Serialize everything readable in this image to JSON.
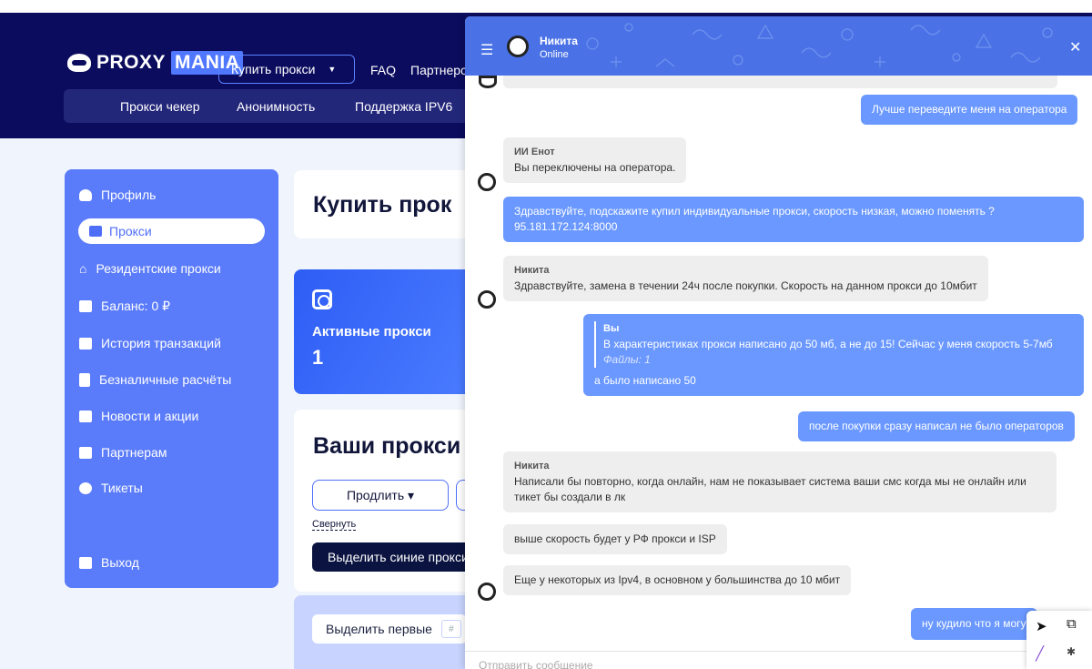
{
  "site": {
    "logo_main": "PROXY",
    "logo_accent": "MANIA",
    "buy_button": "Купить прокси",
    "nav": [
      "FAQ",
      "Партнерс"
    ],
    "subnav": [
      "Прокси чекер",
      "Анонимность",
      "Поддержка IPV6"
    ]
  },
  "sidebar": {
    "items": [
      {
        "label": "Профиль",
        "icon": "user-icon"
      },
      {
        "label": "Прокси",
        "icon": "proxy-icon",
        "active": true
      },
      {
        "label": "Резидентские прокси",
        "icon": "home-icon"
      },
      {
        "label": "Баланс: 0 ₽",
        "icon": "wallet-icon"
      },
      {
        "label": "История транзакций",
        "icon": "history-icon"
      },
      {
        "label": "Безналичные расчёты",
        "icon": "document-icon"
      },
      {
        "label": "Новости и акции",
        "icon": "news-icon"
      },
      {
        "label": "Партнерам",
        "icon": "handshake-icon"
      },
      {
        "label": "Тикеты",
        "icon": "chat-icon"
      },
      {
        "label": "Выход",
        "icon": "logout-icon"
      }
    ]
  },
  "main": {
    "buy_title": "Купить прок",
    "active_label": "Активные прокси",
    "active_count": "1",
    "your_proxies_title": "Ваши прокси",
    "prolong_button": "Продлить ▾",
    "collapse_link": "Свернуть",
    "highlight_blue_button": "Выделить синие прокси",
    "select_first_label": "Выделить первые",
    "select_first_placeholder": "#"
  },
  "chat": {
    "contact_name": "Никита",
    "contact_status": "Online",
    "messages": {
      "m1": "Лучше переведите меня на оператора",
      "m2_author": "ИИ Енот",
      "m2": "Вы переключены на оператора.",
      "m3_line1": "Здравствуйте, подскажите купил индивидуальные прокси, скорость низкая, можно поменять ?",
      "m3_line2": "95.181.172.124:8000",
      "m4_author": "Никита",
      "m4": "Здравствуйте, замена в течении 24ч после покупки. Скорость на данном прокси до 10мбит",
      "m5_quote_author": "Вы",
      "m5_quote_text": "В характеристиках прокси написано до 50 мб, а не до 15! Сейчас у меня скорость 5-7мб",
      "m5_quote_files": "Файлы: 1",
      "m5_text": "а было написано 50",
      "m6": "после покупки сразу написал не было операторов",
      "m7_author": "Никита",
      "m7_line1": "Написали бы повторно, когда онлайн, нам не показывает система ваши смс когда мы не онлайн или",
      "m7_line2": "тикет бы создали в лк",
      "m8": "выше скорость будет у РФ прокси и ISP",
      "m9": "Еще у некоторых из Ipv4, в основном у большинства до 10 мбит",
      "m10": "ну кудило что я могу"
    },
    "input_placeholder": "Отправить сообщение"
  },
  "colors": {
    "header_bg": "#0b0c5e",
    "sidebar_bg": "#5b7cfa",
    "chat_header": "#4a72e6",
    "outgoing_bubble": "#6a98ff"
  }
}
